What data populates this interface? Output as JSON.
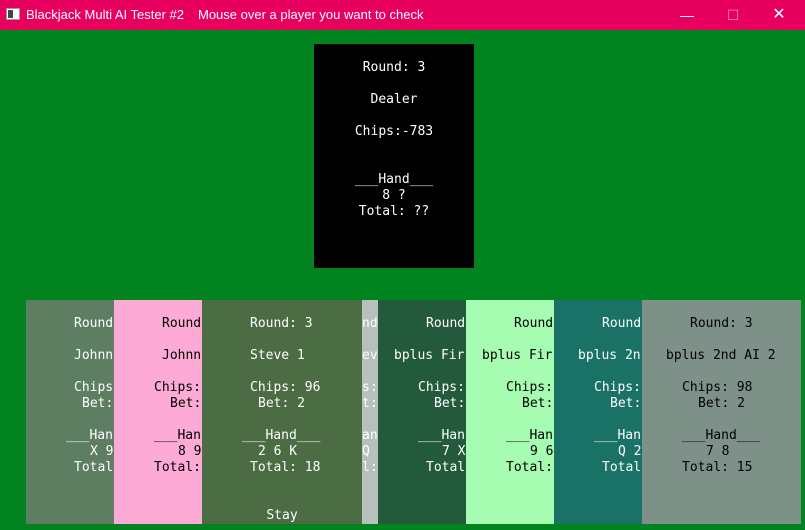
{
  "window": {
    "title": "Blackjack Multi AI Tester #2",
    "subtitle": "Mouse over a player you want to check",
    "buttons": {
      "minimize": "—",
      "maximize": "☐",
      "close": "✕"
    }
  },
  "colors": {
    "table": "#018420",
    "titlebar": "#e8005f",
    "dealer_panel": "#000000"
  },
  "dealer": {
    "round": "Round: 3",
    "name": "Dealer",
    "chips": "Chips:-783",
    "hand_header": "___Hand___",
    "cards": "8 ?",
    "total": "Total: ??"
  },
  "players": [
    {
      "bg": "#5e7e62",
      "fg": "#ffffff",
      "round": "Round",
      "name": "Johnn",
      "chips": "Chips",
      "bet": "Bet:",
      "hand": "___Han",
      "cards": "X 9",
      "total": "Total"
    },
    {
      "bg": "#fdaad6",
      "fg": "#000000",
      "round": "Round",
      "name": "Johnn",
      "chips": "Chips:",
      "bet": "Bet:",
      "hand": "___Han",
      "cards": "8 9",
      "total": "Total:"
    },
    {
      "bg": "#b8c0bc",
      "fg": "#ffffff",
      "round": "nd",
      "name": "ev",
      "chips": "s:",
      "bet": "t:",
      "hand": "an",
      "cards": "Q",
      "total": "l:"
    },
    {
      "bg": "#235a3c",
      "fg": "#ffffff",
      "round": "Round",
      "name": "bplus Fir",
      "chips": "Chips:",
      "bet": "Bet:",
      "hand": "___Han",
      "cards": "7 X",
      "total": "Total"
    },
    {
      "bg": "#a6fdb2",
      "fg": "#000000",
      "round": "Round",
      "name": "bplus Fir",
      "chips": "Chips:",
      "bet": "Bet:",
      "hand": "___Han",
      "cards": "9 6",
      "total": "Total:"
    },
    {
      "bg": "#197265",
      "fg": "#ffffff",
      "round": "Round",
      "name": "bplus 2n",
      "chips": "Chips:",
      "bet": "Bet:",
      "hand": "___Han",
      "cards": "Q 2",
      "total": "Total"
    },
    {
      "bg": "#4c6c44",
      "fg": "#ffffff",
      "round": "Round: 3",
      "name": "Steve 1",
      "chips": "Chips: 96",
      "bet": "Bet: 2",
      "hand": "___Hand___",
      "cards": "2 6 K",
      "total": "Total: 18",
      "status": "Stay"
    },
    {
      "bg": "#7d9189",
      "fg": "#000000",
      "round": "Round: 3",
      "name": "bplus 2nd AI 2",
      "chips": "Chips: 98",
      "bet": "Bet: 2",
      "hand": "___Hand___",
      "cards": "7 8",
      "total": "Total: 15"
    }
  ]
}
